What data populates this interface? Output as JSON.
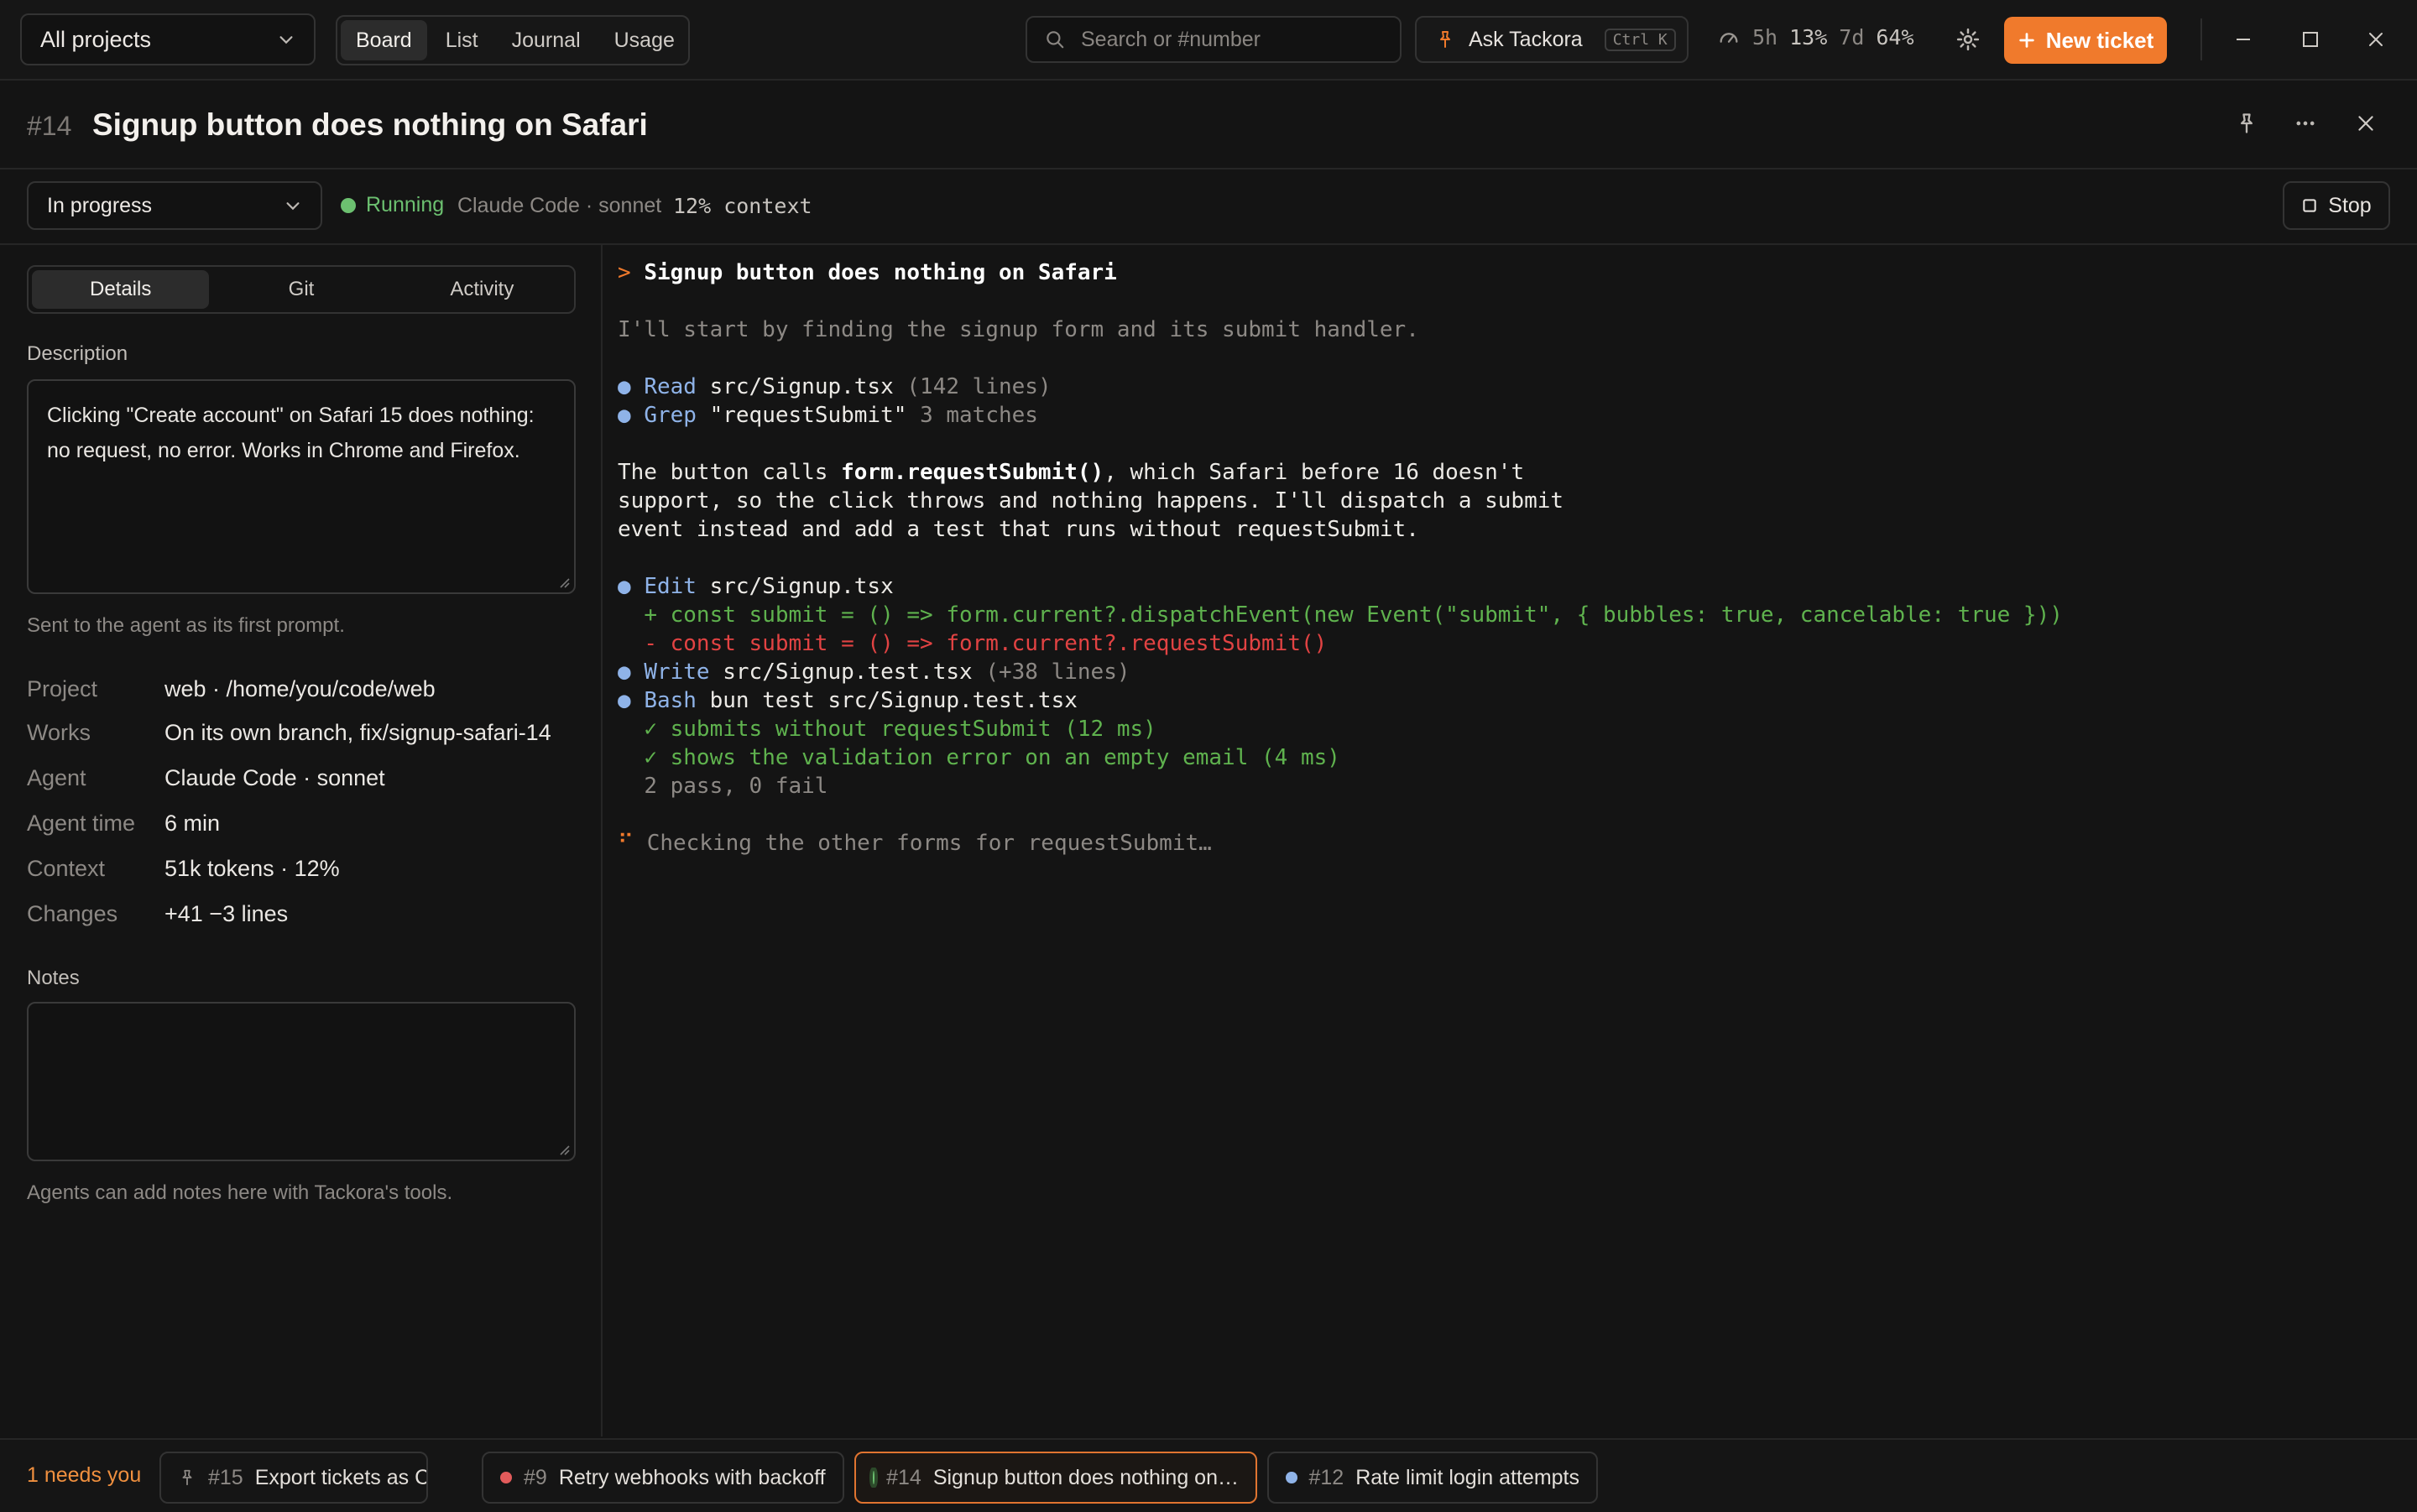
{
  "topbar": {
    "project_select": "All projects",
    "view_tabs": [
      {
        "label": "Board",
        "active": true
      },
      {
        "label": "List",
        "active": false
      },
      {
        "label": "Journal",
        "active": false
      },
      {
        "label": "Usage",
        "active": false
      }
    ],
    "search_placeholder": "Search or #number",
    "ask_label": "Ask Tackora",
    "ask_shortcut": "Ctrl K",
    "usage": {
      "window1": "5h",
      "window1_pct": "13%",
      "window2": "7d",
      "window2_pct": "64%"
    },
    "new_ticket_label": "New ticket",
    "accent": "#f07a2c"
  },
  "ticket": {
    "number": "#14",
    "title": "Signup button does nothing on Safari",
    "status_select": "In progress",
    "run_status": "Running",
    "run_status_color": "#6cc070",
    "agent_info": "Claude Code · sonnet",
    "context": "12% context",
    "stop_label": "Stop"
  },
  "left": {
    "tabs": [
      {
        "label": "Details",
        "active": true
      },
      {
        "label": "Git",
        "active": false
      },
      {
        "label": "Activity",
        "active": false
      }
    ],
    "description_label": "Description",
    "description_line1": "Clicking \"Create account\" on Safari 15 does nothing:",
    "description_line2": "no request, no error. Works in Chrome and Firefox.",
    "description_hint": "Sent to the agent as its first prompt.",
    "details": [
      {
        "key": "Project",
        "value": "web · /home/you/code/web"
      },
      {
        "key": "Works",
        "value": "On its own branch, fix/signup-safari-14"
      },
      {
        "key": "Agent",
        "value": "Claude Code · sonnet"
      },
      {
        "key": "Agent time",
        "value": "6 min"
      },
      {
        "key": "Context",
        "value": "51k tokens · 12%"
      },
      {
        "key": "Changes",
        "value": "+41 −3 lines"
      }
    ],
    "notes_label": "Notes",
    "notes_value": "",
    "notes_hint": "Agents can add notes here with Tackora's tools."
  },
  "terminal": {
    "prompt_mark": ">",
    "prompt": "Signup button does nothing on Safari",
    "intro": "I'll start by finding the signup form and its submit handler.",
    "read_tool": "Read",
    "read_target": "src/Signup.tsx",
    "read_meta": "(142 lines)",
    "grep_tool": "Grep",
    "grep_target": "\"requestSubmit\"",
    "grep_meta": "3 matches",
    "explain_1a": "The button calls ",
    "explain_1b": "form.requestSubmit()",
    "explain_1c": ", which Safari before 16 doesn't",
    "explain_2": "support, so the click throws and nothing happens. I'll dispatch a submit",
    "explain_3": "event instead and add a test that runs without requestSubmit.",
    "edit_tool": "Edit",
    "edit_target": "src/Signup.tsx",
    "diff_add": "+ const submit = () => form.current?.dispatchEvent(new Event(\"submit\", { bubbles: true, cancelable: true }))",
    "diff_del": "- const submit = () => form.current?.requestSubmit()",
    "write_tool": "Write",
    "write_target": "src/Signup.test.tsx",
    "write_meta": "(+38 lines)",
    "bash_tool": "Bash",
    "bash_target": "bun test src/Signup.test.tsx",
    "test1": "✓ submits without requestSubmit (12 ms)",
    "test2": "✓ shows the validation error on an empty email (4 ms)",
    "test_summary": "2 pass, 0 fail",
    "spinner": "⠋",
    "working": "Checking the other forms for requestSubmit…"
  },
  "bottombar": {
    "needs_you": "1 needs you",
    "chips": [
      {
        "number": "#15",
        "title": "Export tickets as CSV",
        "indicator": "pin-icon"
      },
      {
        "number": "#9",
        "title": "Retry webhooks with backoff",
        "indicator_color": "#e25b5b"
      },
      {
        "number": "#14",
        "title": "Signup button does nothing on…",
        "indicator_color": "#6cc070",
        "active": true
      },
      {
        "number": "#12",
        "title": "Rate limit login attempts",
        "indicator_color": "#8fb3e8"
      }
    ]
  }
}
